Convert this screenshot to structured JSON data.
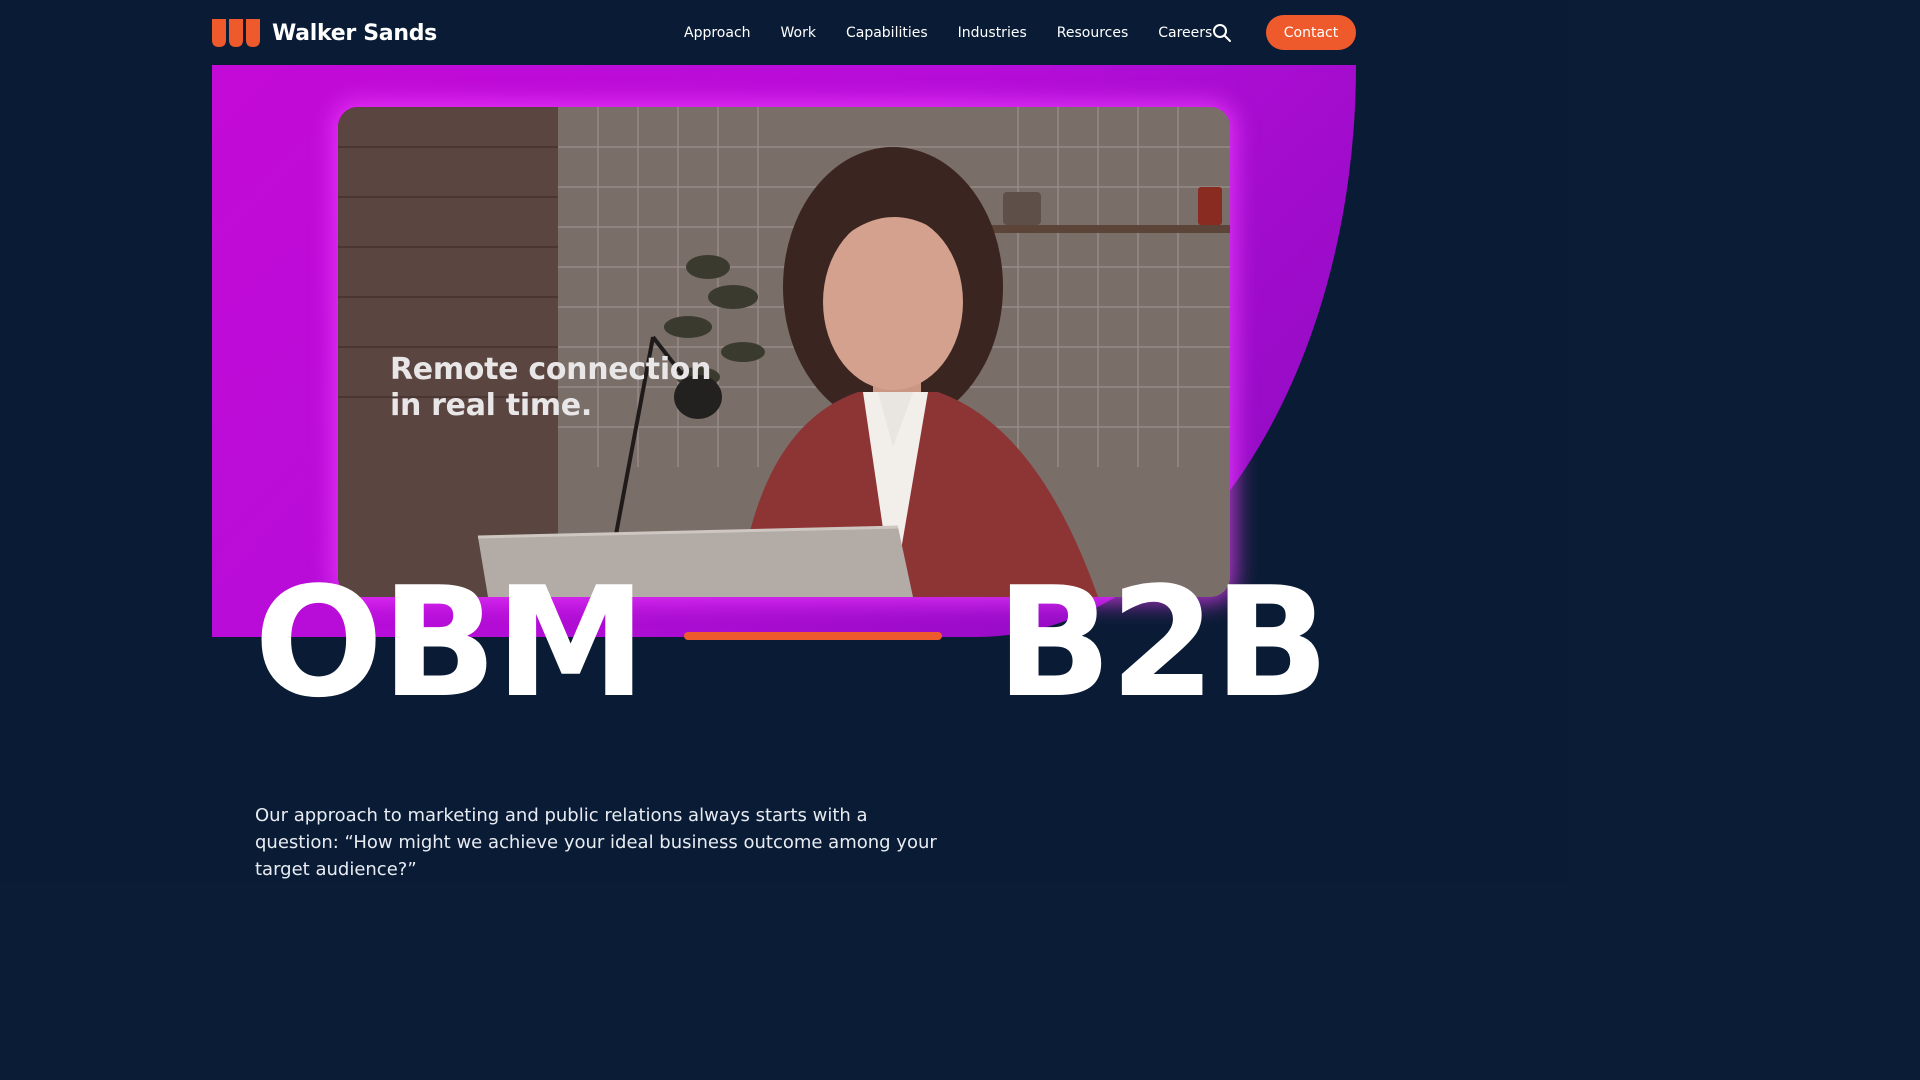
{
  "brand": {
    "name": "Walker Sands",
    "logo_icon": "walker-sands-logo-icon",
    "accent_color": "#ee5a2c"
  },
  "nav": {
    "items": [
      "Approach",
      "Work",
      "Capabilities",
      "Industries",
      "Resources",
      "Careers"
    ],
    "search_icon": "search-icon",
    "contact_label": "Contact"
  },
  "hero": {
    "video_caption_line1": "Remote connection",
    "video_caption_line2": "in real time.",
    "word_left": "OBM",
    "word_right": "B2B",
    "gradient_color": "#c40ad6"
  },
  "intro": {
    "text": "Our approach to marketing and public relations always starts with a question: “How might we achieve your ideal business outcome among your target audience?”"
  }
}
